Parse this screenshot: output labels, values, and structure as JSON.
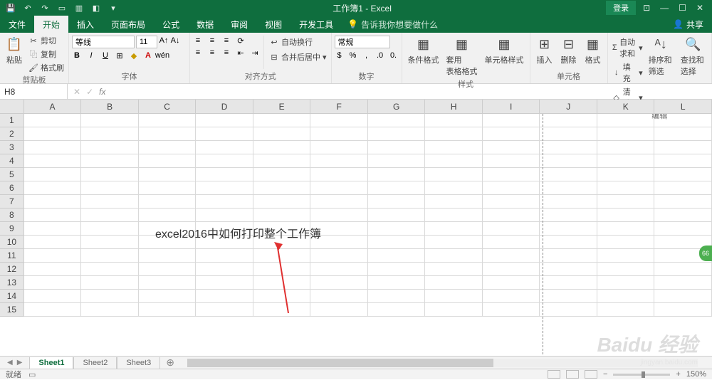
{
  "title": "工作簿1 - Excel",
  "login_label": "登录",
  "menu": {
    "file": "文件",
    "home": "开始",
    "insert": "插入",
    "layout": "页面布局",
    "formula": "公式",
    "data": "数据",
    "review": "审阅",
    "view": "视图",
    "dev": "开发工具",
    "tell_me": "告诉我你想要做什么"
  },
  "share": "共享",
  "ribbon": {
    "clipboard": {
      "paste": "粘贴",
      "cut": "剪切",
      "copy": "复制",
      "painter": "格式刷",
      "label": "剪贴板"
    },
    "font": {
      "name": "等线",
      "size": "11",
      "label": "字体"
    },
    "align": {
      "wrap": "自动换行",
      "merge": "合并后居中",
      "label": "对齐方式"
    },
    "number": {
      "format": "常规",
      "label": "数字"
    },
    "styles": {
      "cond": "条件格式",
      "table": "套用\n表格格式",
      "cell": "单元格样式",
      "label": "样式"
    },
    "cells": {
      "insert": "插入",
      "delete": "删除",
      "format": "格式",
      "label": "单元格"
    },
    "editing": {
      "sum": "自动求和",
      "fill": "填充",
      "clear": "清除",
      "sort": "排序和筛选",
      "find": "查找和选择",
      "label": "编辑"
    }
  },
  "name_box": "H8",
  "columns": [
    "A",
    "B",
    "C",
    "D",
    "E",
    "F",
    "G",
    "H",
    "I",
    "J",
    "K",
    "L"
  ],
  "rows": [
    "1",
    "2",
    "3",
    "4",
    "5",
    "6",
    "7",
    "8",
    "9",
    "10",
    "11",
    "12",
    "13",
    "14",
    "15"
  ],
  "annotation": "excel2016中如何打印整个工作簿",
  "sheets": [
    "Sheet1",
    "Sheet2",
    "Sheet3"
  ],
  "status": {
    "ready": "就绪",
    "zoom": "150%"
  },
  "watermark": "Baidu 经验",
  "watermark_sub": "jingyan.baidu.com",
  "badge": "66"
}
